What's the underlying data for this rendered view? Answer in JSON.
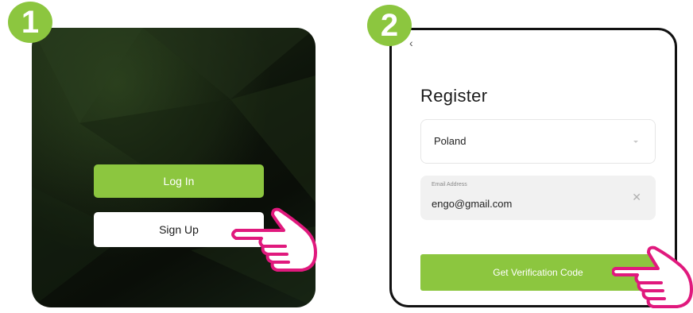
{
  "steps": {
    "step1": "1",
    "step2": "2"
  },
  "panel1": {
    "login_label": "Log In",
    "signup_label": "Sign Up"
  },
  "panel2": {
    "title": "Register",
    "country": {
      "value": "Poland"
    },
    "email": {
      "label": "Email Address",
      "value": "engo@gmail.com",
      "clear_icon": "close-icon"
    },
    "verify_label": "Get Verification Code"
  },
  "colors": {
    "accent": "#8cc63f",
    "pointer": "#e0197d",
    "dark_bg": "#0e150b"
  }
}
